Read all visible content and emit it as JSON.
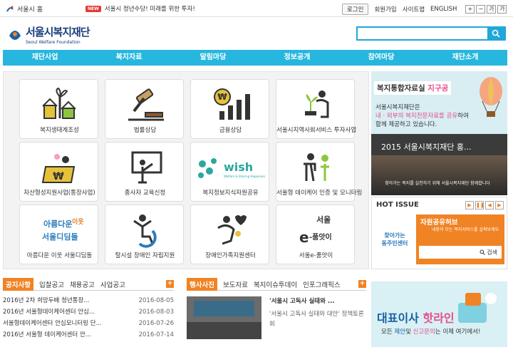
{
  "topbar": {
    "home_label": "서울시 홈",
    "new_badge": "NEW",
    "flash_text": "서울시 청년수당! 미래를 위한 투자!",
    "login": "로그인",
    "join": "회원가입",
    "sitemap": "사이트맵",
    "english": "ENGLISH",
    "font_controls": [
      "+",
      "−",
      "가",
      "가"
    ]
  },
  "logo": {
    "korean": "서울시복지재단",
    "english": "Seoul Welfare Foundation"
  },
  "search": {
    "placeholder": ""
  },
  "nav": [
    "재단사업",
    "복지자료",
    "알림마당",
    "정보공개",
    "참여마당",
    "재단소개"
  ],
  "tiles": [
    {
      "label": "복지생태계조성",
      "icon": "community-tree-icon"
    },
    {
      "label": "법률상담",
      "icon": "gavel-icon"
    },
    {
      "label": "금융상담",
      "icon": "won-chart-icon"
    },
    {
      "label": "서울시지역사회서비스 투자사업",
      "icon": "plant-caregiver-icon"
    },
    {
      "label": "자산형성지원사업(통장사업)",
      "icon": "bankbook-icon"
    },
    {
      "label": "종사자 교육신청",
      "icon": "teacher-icon"
    },
    {
      "label": "복지정보지식자원공유",
      "icon": "wish-logo"
    },
    {
      "label": "서울형 데이케어 인증 및 모니터링",
      "icon": "elder-care-icon"
    },
    {
      "label": "아름다운 이웃 서울디딤돌",
      "icon": "didimdol-logo"
    },
    {
      "label": "탈시설 장애인 자립지원",
      "icon": "wheelchair-icon"
    },
    {
      "label": "장애인가족지원센터",
      "icon": "family-heart-icon"
    },
    {
      "label": "서울e-품앗이",
      "icon": "epumasi-logo"
    }
  ],
  "right_panel": {
    "title_a": "복지통합자료실",
    "title_b": "지구공",
    "text_1": "서울시복지재단은",
    "text_2a": "내 · 외부의 복지전문자료를 공유",
    "text_2b": "하여",
    "text_3": "함께 제공하고 있습니다."
  },
  "video": {
    "title": "2015 서울시복지재단 홍...",
    "subtitle": "찾아가는 복지를 실천하기 위해 서울시복지재단 함께합니다"
  },
  "hot_issue": {
    "title": "HOT ISSUE",
    "controls": [
      "▶",
      "❚❚",
      "◀",
      "▶"
    ],
    "left_text": [
      "찾아가는",
      "동주민센터"
    ],
    "banner_title": "자원공유허브",
    "banner_text": "내용과 모는 복지서비스를 살펴보세요",
    "search_btn": "검색"
  },
  "notice": {
    "tabs": [
      "공지사항",
      "입찰공고",
      "채용공고",
      "사업공고"
    ],
    "plus": "+",
    "rows": [
      {
        "title": "2016년 2차 희망두배 청년통장...",
        "date": "2016-08-05"
      },
      {
        "title": "2016년 서울형데이케어센터 안심...",
        "date": "2016-08-03"
      },
      {
        "title": "서울형데이케어센터 안심모니터링 단...",
        "date": "2016-07-26"
      },
      {
        "title": "2016년 서울형 데이케어센터 안...",
        "date": "2016-07-14"
      }
    ]
  },
  "news": {
    "tabs": [
      "행사사진",
      "보도자료",
      "복지이슈투데이",
      "인포그래픽스"
    ],
    "plus": "+",
    "headline": "'서울시 고독사 실태와 ...",
    "body": "'서울시 고독사 실태와 대안' 정책토론회"
  },
  "banner": {
    "title_a": "대표이사",
    "title_b": "핫라인",
    "line_a": "모든",
    "line_b": "제안",
    "line_c": "및",
    "line_d": "신고문의",
    "line_e": "는 이제 여기에서!"
  },
  "colors": {
    "accent": "#27b6de",
    "orange": "#f08324",
    "pink": "#e74c8b",
    "navy": "#1a3d7c"
  }
}
